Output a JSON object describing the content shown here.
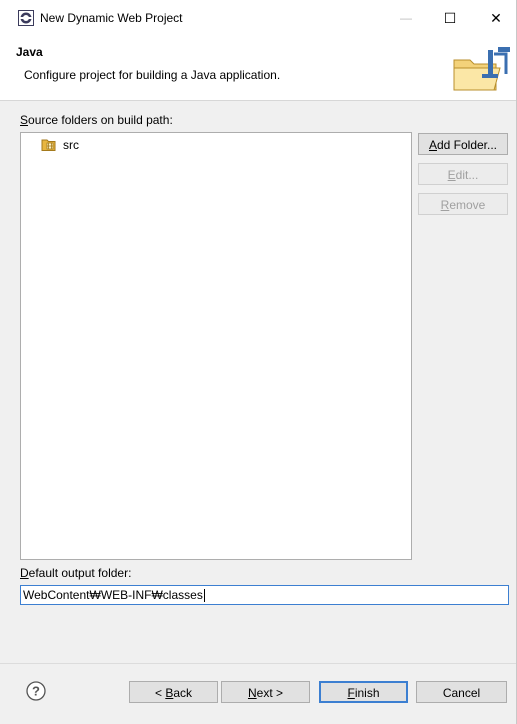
{
  "window": {
    "title": "New Dynamic Web Project",
    "minimize_glyph": "—",
    "maximize_glyph": "☐",
    "close_glyph": "✕"
  },
  "header": {
    "title": "Java",
    "description": "Configure project for building a Java application."
  },
  "source_folders": {
    "label_mnemonic": "S",
    "label_rest": "ource folders on build path:",
    "items": [
      {
        "label": "src",
        "icon": "source-package-folder-icon"
      }
    ]
  },
  "buttons": {
    "add_folder": {
      "mnemonic": "A",
      "rest": "dd Folder...",
      "enabled": true
    },
    "edit": {
      "mnemonic": "E",
      "rest": "dit...",
      "enabled": false
    },
    "remove": {
      "mnemonic": "R",
      "rest": "emove",
      "enabled": false
    }
  },
  "output_folder": {
    "label_mnemonic": "D",
    "label_rest": "efault output folder:",
    "value": "WebContent₩WEB-INF₩classes"
  },
  "footer": {
    "back": {
      "prefix": "< ",
      "mnemonic": "B",
      "rest": "ack"
    },
    "next": {
      "mnemonic": "N",
      "rest": "ext >"
    },
    "finish": {
      "mnemonic": "F",
      "rest": "inish"
    },
    "cancel": {
      "label": "Cancel"
    }
  },
  "colors": {
    "focus_border": "#3c7fd1",
    "folder_yellow": "#e8b640"
  }
}
